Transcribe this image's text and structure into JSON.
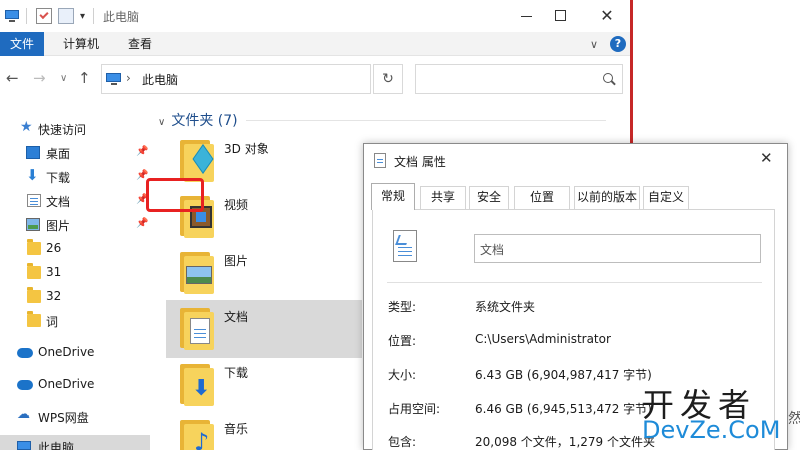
{
  "window": {
    "title": "此电脑"
  },
  "ribbon": {
    "tabs": [
      "文件",
      "计算机",
      "查看"
    ]
  },
  "address": {
    "path": "此电脑",
    "separator": "›"
  },
  "search": {
    "placeholder": ""
  },
  "sidebar": {
    "items": [
      {
        "label": "快速访问",
        "icon": "star-icon"
      },
      {
        "label": "桌面",
        "icon": "desktop-icon",
        "pinned": true
      },
      {
        "label": "下载",
        "icon": "download-icon",
        "pinned": true
      },
      {
        "label": "文档",
        "icon": "document-icon",
        "pinned": true
      },
      {
        "label": "图片",
        "icon": "picture-icon",
        "pinned": true
      },
      {
        "label": "26",
        "icon": "folder-icon"
      },
      {
        "label": "31",
        "icon": "folder-icon"
      },
      {
        "label": "32",
        "icon": "folder-icon"
      },
      {
        "label": "词",
        "icon": "folder-icon"
      },
      {
        "label": "OneDrive",
        "icon": "cloud-icon"
      },
      {
        "label": "OneDrive",
        "icon": "cloud-icon"
      },
      {
        "label": "WPS网盘",
        "icon": "wps-icon"
      },
      {
        "label": "此电脑",
        "icon": "computer-icon",
        "selected": true
      }
    ]
  },
  "content": {
    "section_title": "文件夹 (7)",
    "folders": [
      {
        "name": "3D 对象",
        "overlay": "cube-icon"
      },
      {
        "name": "视频",
        "overlay": "film-icon"
      },
      {
        "name": "图片",
        "overlay": "picture-icon"
      },
      {
        "name": "文档",
        "overlay": "document-icon",
        "selected": true
      },
      {
        "name": "下载",
        "overlay": "download-icon"
      },
      {
        "name": "音乐",
        "overlay": "music-icon"
      }
    ]
  },
  "dialog": {
    "title": "文档 属性",
    "tabs": [
      "常规",
      "共享",
      "安全",
      "位置",
      "以前的版本",
      "自定义"
    ],
    "active_tab": "常规",
    "highlighted_tab": "位置",
    "name_value": "文档",
    "properties": [
      {
        "label": "类型:",
        "value": "系统文件夹"
      },
      {
        "label": "位置:",
        "value": "C:\\Users\\Administrator"
      },
      {
        "label": "大小:",
        "value": "6.43 GB (6,904,987,417 字节)"
      },
      {
        "label": "占用空间:",
        "value": "6.46 GB (6,945,513,472 字节)"
      },
      {
        "label": "包含:",
        "value": "20,098 个文件，1,279 个文件夹"
      }
    ]
  },
  "watermark": {
    "top": "开发者",
    "bottom": "DevZe.CoM",
    "fragment": "然"
  },
  "colors": {
    "accent": "#1f6bbf",
    "highlight_box": "#e82121",
    "window_edge": "#c62828"
  }
}
